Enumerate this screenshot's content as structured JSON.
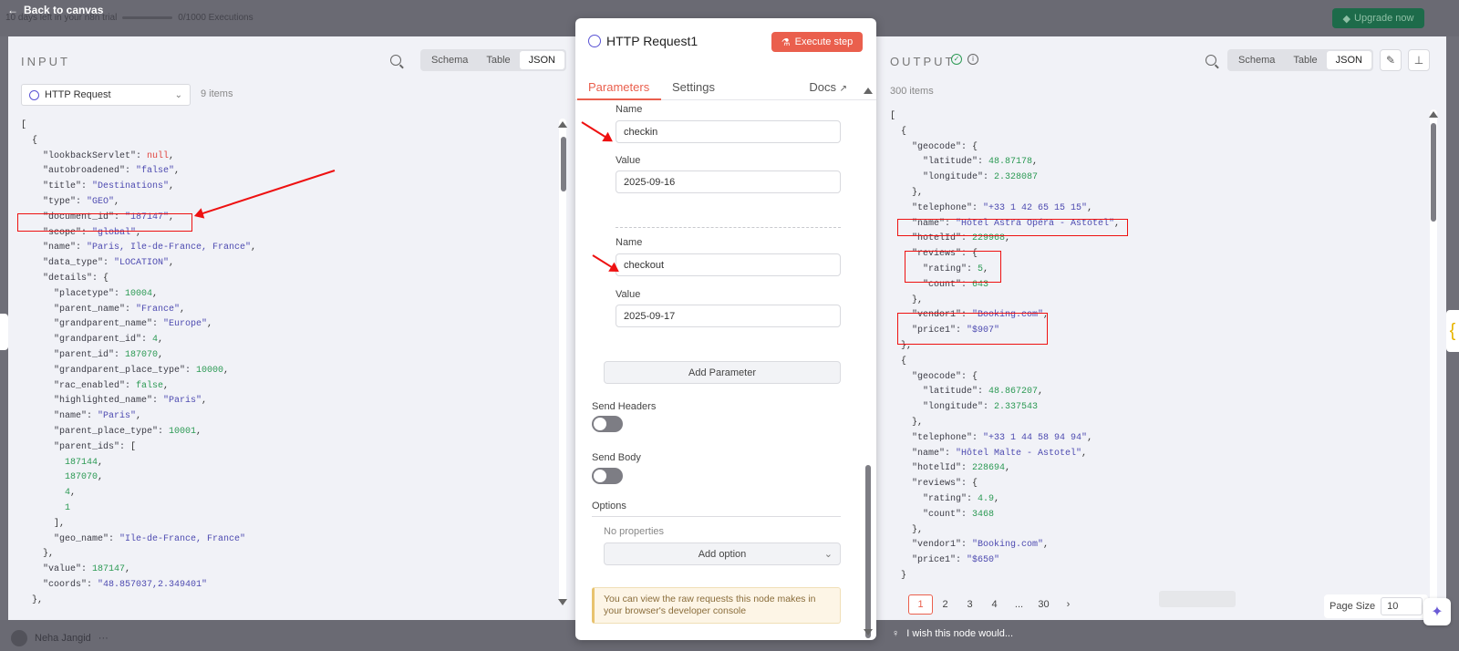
{
  "topbar": {
    "back_label": "Back to canvas",
    "trial_text": "10 days left in your n8n trial",
    "executions": "0/1000 Executions",
    "upgrade_label": "Upgrade now"
  },
  "input_panel": {
    "title": "INPUT",
    "views": [
      "Schema",
      "Table",
      "JSON"
    ],
    "active_view": "JSON",
    "node_selector": "HTTP Request",
    "items_count": "9 items"
  },
  "input_json_lines": [
    [
      [
        "p",
        "["
      ]
    ],
    [
      [
        "p",
        "  {"
      ]
    ],
    [
      [
        "k",
        "    \"lookbackServlet\": "
      ],
      [
        "nl",
        "null"
      ],
      [
        "p",
        ","
      ]
    ],
    [
      [
        "k",
        "    \"autobroadened\": "
      ],
      [
        "s",
        "\"false\""
      ],
      [
        "p",
        ","
      ]
    ],
    [
      [
        "k",
        "    \"title\": "
      ],
      [
        "s",
        "\"Destinations\""
      ],
      [
        "p",
        ","
      ]
    ],
    [
      [
        "k",
        "    \"type\": "
      ],
      [
        "s",
        "\"GEO\""
      ],
      [
        "p",
        ","
      ]
    ],
    [
      [
        "k",
        "    \"document_id\": "
      ],
      [
        "s",
        "\"187147\""
      ],
      [
        "p",
        ","
      ]
    ],
    [
      [
        "k",
        "    \"scope\": "
      ],
      [
        "s",
        "\"global\""
      ],
      [
        "p",
        ","
      ]
    ],
    [
      [
        "k",
        "    \"name\": "
      ],
      [
        "s",
        "\"Paris, Ile-de-France, France\""
      ],
      [
        "p",
        ","
      ]
    ],
    [
      [
        "k",
        "    \"data_type\": "
      ],
      [
        "s",
        "\"LOCATION\""
      ],
      [
        "p",
        ","
      ]
    ],
    [
      [
        "k",
        "    \"details\": "
      ],
      [
        "p",
        "{"
      ]
    ],
    [
      [
        "k",
        "      \"placetype\": "
      ],
      [
        "n",
        "10004"
      ],
      [
        "p",
        ","
      ]
    ],
    [
      [
        "k",
        "      \"parent_name\": "
      ],
      [
        "s",
        "\"France\""
      ],
      [
        "p",
        ","
      ]
    ],
    [
      [
        "k",
        "      \"grandparent_name\": "
      ],
      [
        "s",
        "\"Europe\""
      ],
      [
        "p",
        ","
      ]
    ],
    [
      [
        "k",
        "      \"grandparent_id\": "
      ],
      [
        "n",
        "4"
      ],
      [
        "p",
        ","
      ]
    ],
    [
      [
        "k",
        "      \"parent_id\": "
      ],
      [
        "n",
        "187070"
      ],
      [
        "p",
        ","
      ]
    ],
    [
      [
        "k",
        "      \"grandparent_place_type\": "
      ],
      [
        "n",
        "10000"
      ],
      [
        "p",
        ","
      ]
    ],
    [
      [
        "k",
        "      \"rac_enabled\": "
      ],
      [
        "b",
        "false"
      ],
      [
        "p",
        ","
      ]
    ],
    [
      [
        "k",
        "      \"highlighted_name\": "
      ],
      [
        "s",
        "\"Paris\""
      ],
      [
        "p",
        ","
      ]
    ],
    [
      [
        "k",
        "      \"name\": "
      ],
      [
        "s",
        "\"Paris\""
      ],
      [
        "p",
        ","
      ]
    ],
    [
      [
        "k",
        "      \"parent_place_type\": "
      ],
      [
        "n",
        "10001"
      ],
      [
        "p",
        ","
      ]
    ],
    [
      [
        "k",
        "      \"parent_ids\": "
      ],
      [
        "p",
        "["
      ]
    ],
    [
      [
        "n",
        "        187144"
      ],
      [
        "p",
        ","
      ]
    ],
    [
      [
        "n",
        "        187070"
      ],
      [
        "p",
        ","
      ]
    ],
    [
      [
        "n",
        "        4"
      ],
      [
        "p",
        ","
      ]
    ],
    [
      [
        "n",
        "        1"
      ]
    ],
    [
      [
        "p",
        "      ],"
      ]
    ],
    [
      [
        "k",
        "      \"geo_name\": "
      ],
      [
        "s",
        "\"Ile-de-France, France\""
      ]
    ],
    [
      [
        "p",
        "    },"
      ]
    ],
    [
      [
        "k",
        "    \"value\": "
      ],
      [
        "n",
        "187147"
      ],
      [
        "p",
        ","
      ]
    ],
    [
      [
        "k",
        "    \"coords\": "
      ],
      [
        "s",
        "\"48.857037,2.349401\""
      ]
    ],
    [
      [
        "p",
        "  },"
      ]
    ]
  ],
  "modal": {
    "title": "HTTP Request1",
    "execute_label": "Execute step",
    "tabs": [
      "Parameters",
      "Settings"
    ],
    "docs_label": "Docs",
    "param1": {
      "name_label": "Name",
      "name_value": "checkin",
      "value_label": "Value",
      "value_value": "2025-09-16"
    },
    "param2": {
      "name_label": "Name",
      "name_value": "checkout",
      "value_label": "Value",
      "value_value": "2025-09-17"
    },
    "add_parameter": "Add Parameter",
    "send_headers": "Send Headers",
    "send_body": "Send Body",
    "options_label": "Options",
    "no_properties": "No properties",
    "add_option": "Add option",
    "notice": "You can view the raw requests this node makes in your browser's developer console"
  },
  "output_panel": {
    "title": "OUTPUT",
    "views": [
      "Schema",
      "Table",
      "JSON"
    ],
    "active_view": "JSON",
    "items_count": "300 items",
    "pages": [
      "1",
      "2",
      "3",
      "4",
      "...",
      "30"
    ],
    "page_size_label": "Page Size",
    "page_size_value": "10",
    "wish_text": "I wish this node would..."
  },
  "output_json_lines": [
    [
      [
        "p",
        "["
      ]
    ],
    [
      [
        "p",
        "  {"
      ]
    ],
    [
      [
        "k",
        "    \"geocode\": "
      ],
      [
        "p",
        "{"
      ]
    ],
    [
      [
        "k",
        "      \"latitude\": "
      ],
      [
        "n",
        "48.87178"
      ],
      [
        "p",
        ","
      ]
    ],
    [
      [
        "k",
        "      \"longitude\": "
      ],
      [
        "n",
        "2.328087"
      ]
    ],
    [
      [
        "p",
        "    },"
      ]
    ],
    [
      [
        "k",
        "    \"telephone\": "
      ],
      [
        "s",
        "\"+33 1 42 65 15 15\""
      ],
      [
        "p",
        ","
      ]
    ],
    [
      [
        "k",
        "    \"name\": "
      ],
      [
        "s",
        "\"Hôtel Astra Opéra - Astotel\""
      ],
      [
        "p",
        ","
      ]
    ],
    [
      [
        "k",
        "    \"hotelId\": "
      ],
      [
        "n",
        "229968"
      ],
      [
        "p",
        ","
      ]
    ],
    [
      [
        "k",
        "    \"reviews\": "
      ],
      [
        "p",
        "{"
      ]
    ],
    [
      [
        "k",
        "      \"rating\": "
      ],
      [
        "n",
        "5"
      ],
      [
        "p",
        ","
      ]
    ],
    [
      [
        "k",
        "      \"count\": "
      ],
      [
        "n",
        "643"
      ]
    ],
    [
      [
        "p",
        "    },"
      ]
    ],
    [
      [
        "k",
        "    \"vendor1\": "
      ],
      [
        "s",
        "\"Booking.com\""
      ],
      [
        "p",
        ","
      ]
    ],
    [
      [
        "k",
        "    \"price1\": "
      ],
      [
        "s",
        "\"$907\""
      ]
    ],
    [
      [
        "p",
        "  },"
      ]
    ],
    [
      [
        "p",
        "  {"
      ]
    ],
    [
      [
        "k",
        "    \"geocode\": "
      ],
      [
        "p",
        "{"
      ]
    ],
    [
      [
        "k",
        "      \"latitude\": "
      ],
      [
        "n",
        "48.867207"
      ],
      [
        "p",
        ","
      ]
    ],
    [
      [
        "k",
        "      \"longitude\": "
      ],
      [
        "n",
        "2.337543"
      ]
    ],
    [
      [
        "p",
        "    },"
      ]
    ],
    [
      [
        "k",
        "    \"telephone\": "
      ],
      [
        "s",
        "\"+33 1 44 58 94 94\""
      ],
      [
        "p",
        ","
      ]
    ],
    [
      [
        "k",
        "    \"name\": "
      ],
      [
        "s",
        "\"Hôtel Malte - Astotel\""
      ],
      [
        "p",
        ","
      ]
    ],
    [
      [
        "k",
        "    \"hotelId\": "
      ],
      [
        "n",
        "228694"
      ],
      [
        "p",
        ","
      ]
    ],
    [
      [
        "k",
        "    \"reviews\": "
      ],
      [
        "p",
        "{"
      ]
    ],
    [
      [
        "k",
        "      \"rating\": "
      ],
      [
        "n",
        "4.9"
      ],
      [
        "p",
        ","
      ]
    ],
    [
      [
        "k",
        "      \"count\": "
      ],
      [
        "n",
        "3468"
      ]
    ],
    [
      [
        "p",
        "    },"
      ]
    ],
    [
      [
        "k",
        "    \"vendor1\": "
      ],
      [
        "s",
        "\"Booking.com\""
      ],
      [
        "p",
        ","
      ]
    ],
    [
      [
        "k",
        "    \"price1\": "
      ],
      [
        "s",
        "\"$650\""
      ]
    ],
    [
      [
        "p",
        "  }"
      ]
    ]
  ],
  "user": {
    "name": "Neha Jangid"
  },
  "colors": {
    "accent": "#ea5f4d",
    "highlight": "#e11111",
    "success": "#2c9a54"
  }
}
